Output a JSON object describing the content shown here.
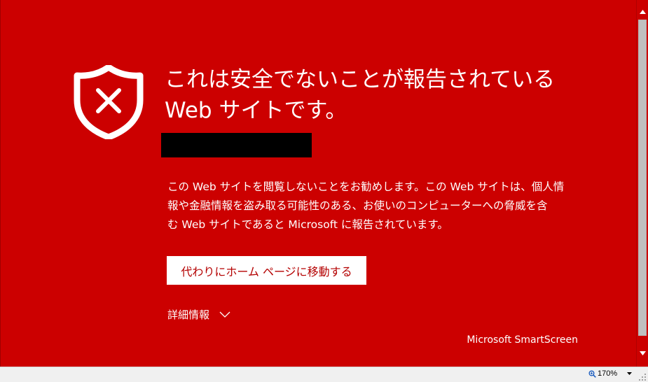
{
  "warning": {
    "heading_lines": [
      "これは安全でないことが報告されている",
      "Web サイトです。"
    ],
    "body_lines": [
      "この Web サイトを閲覧しないことをお勧めします。この Web サイトは、個人情",
      "報や金融情報を盗み取る可能性のある、お使いのコンピューターへの脅威を含",
      "む Web サイトであると Microsoft に報告されています。"
    ],
    "primary_button_label": "代わりにホーム ページに移動する",
    "details_label": "詳細情報",
    "brand": "Microsoft SmartScreen"
  },
  "statusbar": {
    "zoom": "170%"
  },
  "colors": {
    "background": "#cc0000",
    "button_text": "#b40000",
    "text": "#ffffff"
  },
  "icons": {
    "warning": "shield-x-icon",
    "details": "chevron-down-icon",
    "scroll_up": "triangle-up-icon",
    "scroll_down": "triangle-down-icon",
    "zoom": "magnifier-icon",
    "zoom_menu": "caret-down-icon"
  }
}
